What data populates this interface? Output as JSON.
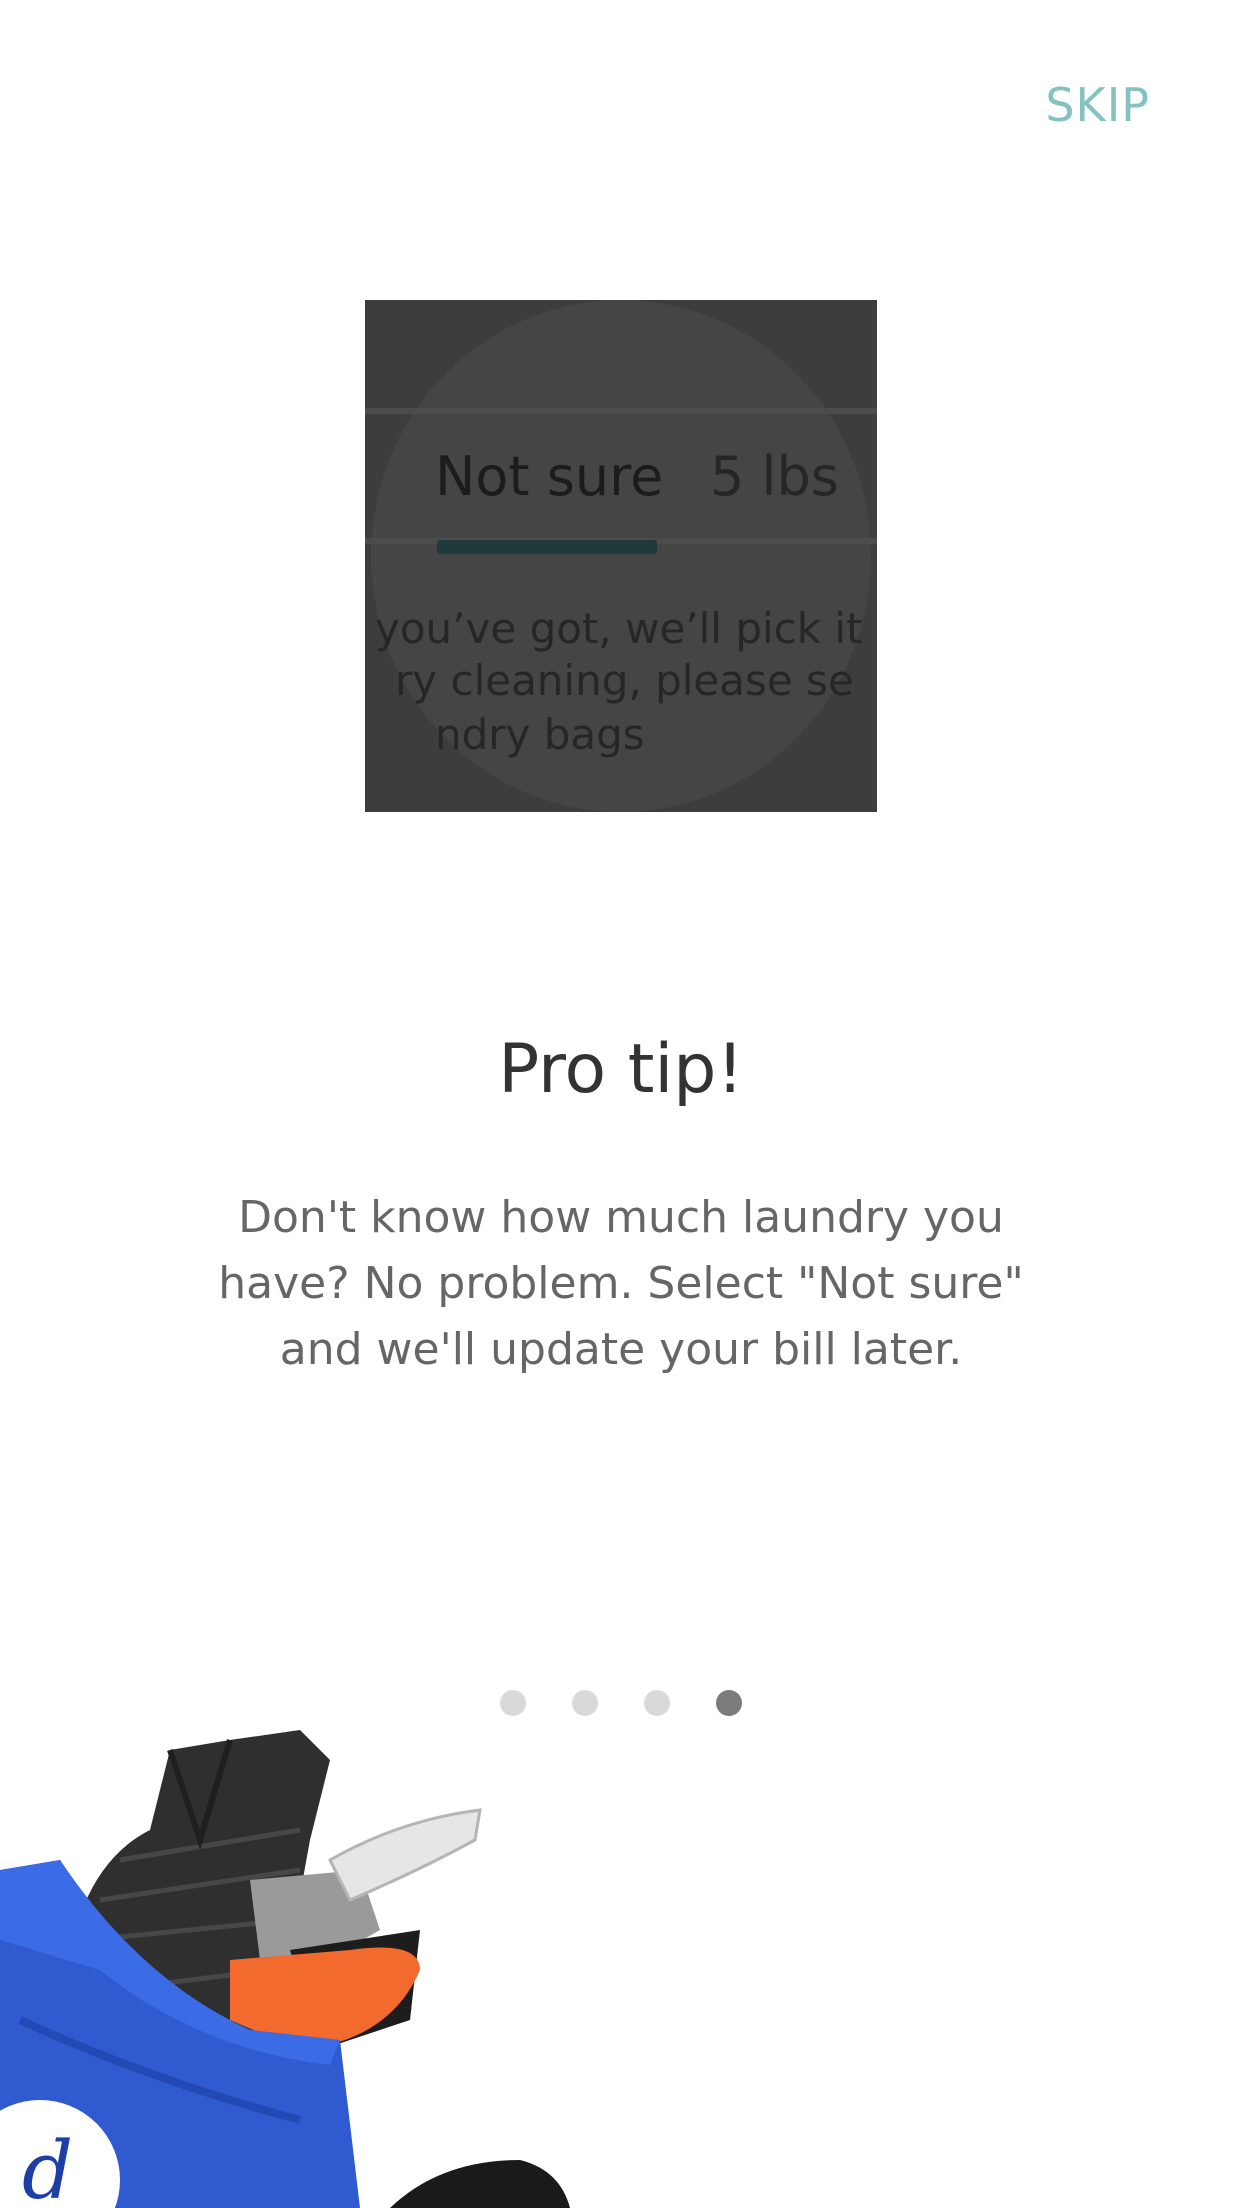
{
  "header": {
    "skip_label": "SKIP"
  },
  "preview": {
    "tab_active": "Not sure",
    "tab_inactive": "5 lbs",
    "desc_lines": [
      "you’ve got, we’ll pick it u",
      "ry cleaning, please se",
      "ndry bags"
    ]
  },
  "content": {
    "title": "Pro tip!",
    "body_lines": [
      "Don't know how much laundry you",
      "have? No problem. Select \"Not sure\"",
      "and we'll update your bill later."
    ]
  },
  "pager": {
    "count": 4,
    "active_index": 3
  },
  "illustration": {
    "icon": "laundry-bag-illustration",
    "bag_logo_text": "d"
  },
  "colors": {
    "accent": "#84c2c2",
    "dot_inactive": "#d9d9d9",
    "dot_active": "#7b7b7b"
  }
}
